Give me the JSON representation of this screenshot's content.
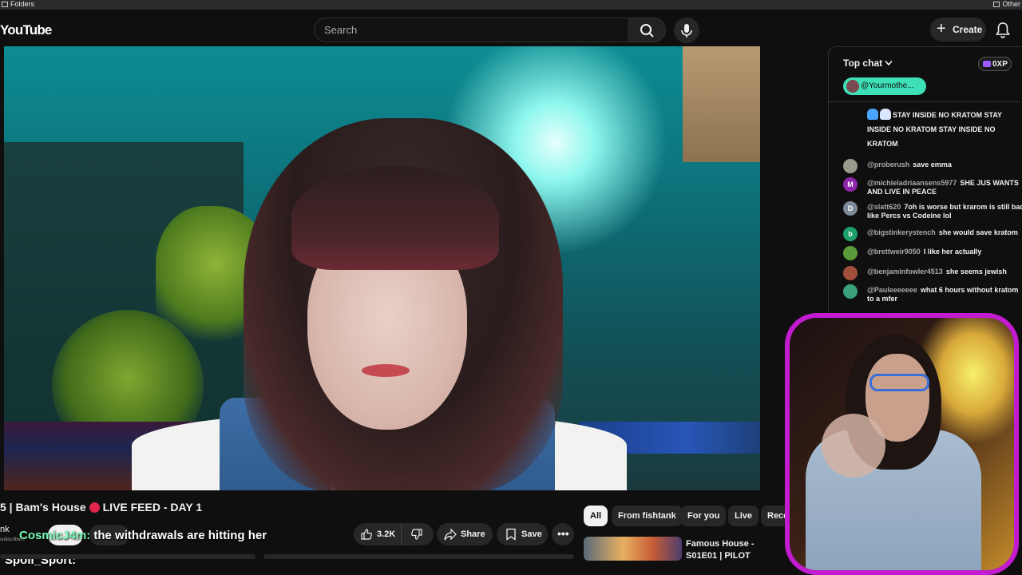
{
  "bookmarks": {
    "left_label": "Folders",
    "right_label": "Other"
  },
  "header": {
    "logo": "YouTube",
    "search_placeholder": "Search",
    "create_label": "Create"
  },
  "video": {
    "title_prefix": "5 | Bam's House",
    "title_suffix": "LIVE FEED - DAY 1",
    "channel": "nk",
    "subs": "subscribers",
    "like_count": "3.2K",
    "share_label": "Share",
    "save_label": "Save",
    "more_label": "•••"
  },
  "overlay": {
    "chat_user": "CosmicJ4m:",
    "chat_text": "the withdrawals are hitting her",
    "chat2_user": "Spoil_Sport:"
  },
  "chips": [
    "All",
    "From fishtank",
    "For you",
    "Live",
    "Rece"
  ],
  "recommended": {
    "title": "Famous House - S01E01 | PILOT"
  },
  "chat": {
    "header": "Top chat",
    "xp": "0XP",
    "pinned_user": "@Yourmothe...",
    "messages": [
      {
        "user": "",
        "text": "STAY INSIDE NO KRATOM  STAY INSIDE NO KRATOM  STAY INSIDE NO KRATOM",
        "avatar": "",
        "color": "#555555"
      },
      {
        "user": "@proberush",
        "text": "save emma",
        "avatar": "",
        "color": "#9a9a8a"
      },
      {
        "user": "@michieladriaansens5977",
        "text": "SHE JUS WANTS AND LIVE IN PEACE",
        "avatar": "M",
        "color": "#8e24aa"
      },
      {
        "user": "@slatt620",
        "text": "7oh is worse but krarom is still bad like Percs vs Codeine lol",
        "avatar": "D",
        "color": "#7c8a99"
      },
      {
        "user": "@bigstinkerystench",
        "text": "she would save kratom",
        "avatar": "b",
        "color": "#1e9e6a"
      },
      {
        "user": "@brettweir9050",
        "text": "I like her actually",
        "avatar": "",
        "color": "#5a9a3a"
      },
      {
        "user": "@benjaminfowler4513",
        "text": "she seems jewish",
        "avatar": "",
        "color": "#a0503a"
      },
      {
        "user": "@Pauleeeeeee",
        "text": "what 6 hours without kratom to a mfer",
        "avatar": "",
        "color": "#3aa07a"
      }
    ]
  },
  "colors": {
    "accent_live": "#e0244c",
    "pinned_bg": "#3ee0b7",
    "webcam_border": "#c21bd0"
  }
}
